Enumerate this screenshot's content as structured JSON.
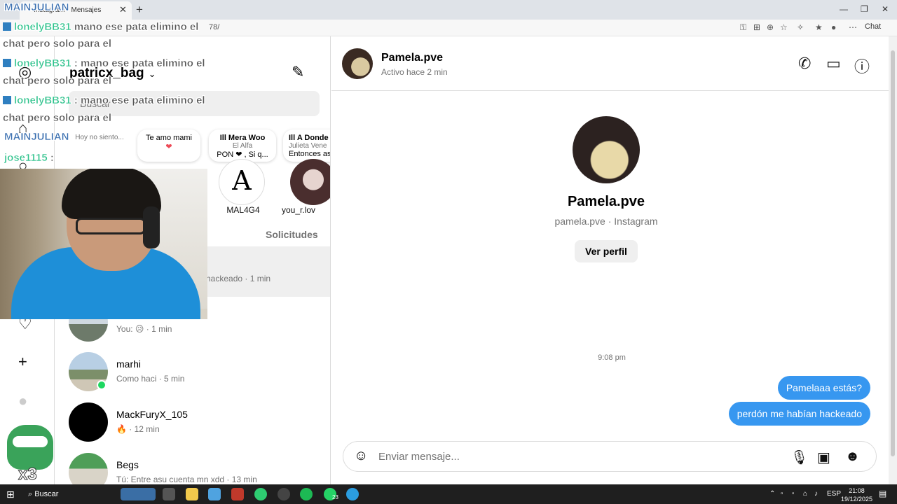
{
  "browser": {
    "tab_title": "Instagram • Mensajes",
    "url": "78/",
    "chat_label": "Chat"
  },
  "nav": {
    "icons": [
      "instagram-icon",
      "home-icon",
      "search-icon",
      "heart-icon",
      "create-icon",
      "profile-icon"
    ]
  },
  "list": {
    "username": "patricx_bag",
    "search_placeholder": "Buscar",
    "notes": [
      {
        "line1": "Hoy no siento...",
        "line2": "",
        "line3": ""
      },
      {
        "line1": "Te amo mami",
        "line2": "❤",
        "line3": ""
      },
      {
        "line1": "Ill Mera Woo",
        "line2": "El Alfa",
        "line3": "PON ❤ , Si q..."
      },
      {
        "line1": "Ill A Donde",
        "line2": "Julieta Vene",
        "line3": "Entonces así"
      }
    ],
    "note_names": [
      "MAL4G4",
      "you_r.lov"
    ],
    "requests_tab": "Solicitudes",
    "conversations": [
      {
        "name": "",
        "preview": "hackeado · 1 min"
      },
      {
        "name": "",
        "preview": "You: 😥 · 1 min"
      },
      {
        "name": "marhi",
        "preview": "Como haci · 5 min"
      },
      {
        "name": "MackFuryX_105",
        "preview": "🔥 · 12 min"
      },
      {
        "name": "Begs",
        "preview": "Tú: Entre asu cuenta mn xdd · 13 min"
      }
    ]
  },
  "chat": {
    "contact_name": "Pamela.pve",
    "contact_status": "Activo hace 2 min",
    "profile_name": "Pamela.pve",
    "profile_sub": "pamela.pve · Instagram",
    "profile_button": "Ver perfil",
    "timestamp": "9:08 pm",
    "messages": [
      {
        "text": "Pamelaaa estás?"
      },
      {
        "text": "perdón me habían hackeado"
      }
    ],
    "composer_placeholder": "Enviar mensaje..."
  },
  "stream_chat": [
    {
      "user": "MAINJULIAN",
      "text": ""
    },
    {
      "user": "lonelyBB31",
      "text": " mano ese pata elimino el"
    },
    {
      "user": "",
      "text": "chat pero solo para el"
    },
    {
      "user": "lonelyBB31",
      "text": " : mano ese pata elimino el"
    },
    {
      "user": "",
      "text": "chat pero solo para el"
    },
    {
      "user": "lonelyBB31",
      "text": " : mano ese pata elimino el"
    },
    {
      "user": "",
      "text": "chat pero solo para el"
    },
    {
      "user": "MAINJULIAN",
      "text": ""
    },
    {
      "user": "jose1115",
      "text": " :"
    }
  ],
  "stream_badge": "x3",
  "taskbar": {
    "search_label": "Buscar",
    "language": "ESP",
    "time": "21:08",
    "date": "19/12/2025",
    "badge": "23"
  },
  "colors": {
    "message_bubble": "#3797f0",
    "online_dot": "#1ed760",
    "stream_username": "#2ec28c"
  }
}
